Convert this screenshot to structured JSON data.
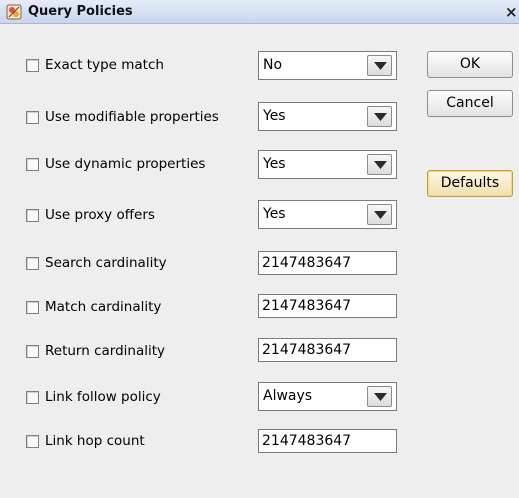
{
  "window": {
    "title": "Query Policies",
    "close_glyph": "×"
  },
  "icons": {
    "app": "query-policies-app-icon",
    "close": "close-icon",
    "dropdown": "chevron-down-icon"
  },
  "colors": {
    "titlebar": "#c8d6ec",
    "window_bg": "#eeeeee",
    "defaults_button_border": "#c79a3a"
  },
  "policies": [
    {
      "label": "Exact type match",
      "checked": false,
      "control": "select",
      "value": "No"
    },
    {
      "label": "Use modifiable properties",
      "checked": false,
      "control": "select",
      "value": "Yes"
    },
    {
      "label": "Use dynamic properties",
      "checked": false,
      "control": "select",
      "value": "Yes"
    },
    {
      "label": "Use proxy offers",
      "checked": false,
      "control": "select",
      "value": "Yes"
    },
    {
      "label": "Search cardinality",
      "checked": false,
      "control": "text",
      "value": "2147483647"
    },
    {
      "label": "Match cardinality",
      "checked": false,
      "control": "text",
      "value": "2147483647"
    },
    {
      "label": "Return cardinality",
      "checked": false,
      "control": "text",
      "value": "2147483647"
    },
    {
      "label": "Link follow policy",
      "checked": false,
      "control": "select",
      "value": "Always"
    },
    {
      "label": "Link hop count",
      "checked": false,
      "control": "text",
      "value": "2147483647"
    }
  ],
  "buttons": {
    "ok": "OK",
    "cancel": "Cancel",
    "defaults": "Defaults"
  }
}
